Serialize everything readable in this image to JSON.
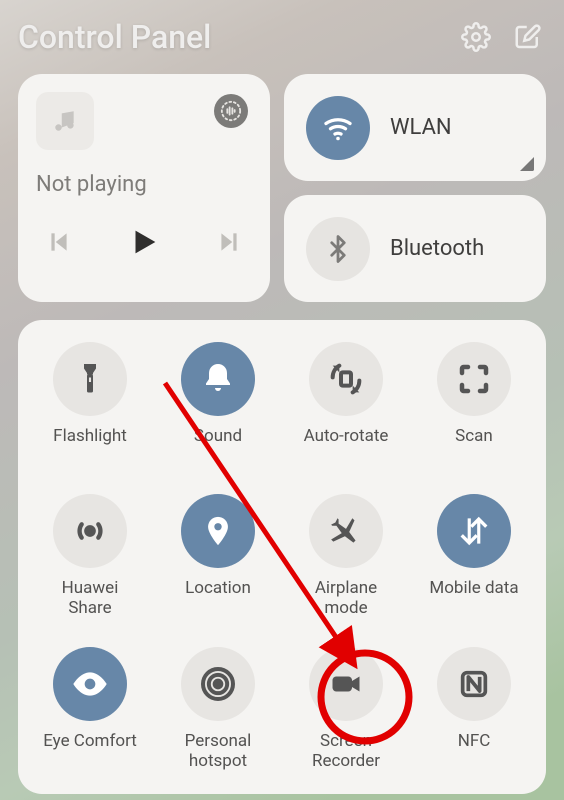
{
  "header": {
    "title": "Control Panel"
  },
  "music": {
    "status": "Not playing"
  },
  "conn": {
    "wlan": {
      "label": "WLAN",
      "on": true
    },
    "bluetooth": {
      "label": "Bluetooth",
      "on": false
    }
  },
  "toggles": [
    {
      "id": "flashlight",
      "label": "Flashlight",
      "icon": "flashlight",
      "on": false
    },
    {
      "id": "sound",
      "label": "Sound",
      "icon": "bell",
      "on": true
    },
    {
      "id": "autorotate",
      "label": "Auto-rotate",
      "icon": "rotate",
      "on": false
    },
    {
      "id": "scan",
      "label": "Scan",
      "icon": "scan",
      "on": false
    },
    {
      "id": "huaweishare",
      "label": "Huawei\nShare",
      "icon": "broadcast",
      "on": false
    },
    {
      "id": "location",
      "label": "Location",
      "icon": "location",
      "on": true
    },
    {
      "id": "airplane",
      "label": "Airplane\nmode",
      "icon": "airplane",
      "on": false
    },
    {
      "id": "mobiledata",
      "label": "Mobile data",
      "icon": "data",
      "on": true
    },
    {
      "id": "eyecomfort",
      "label": "Eye Comfort",
      "icon": "eye",
      "on": true
    },
    {
      "id": "hotspot",
      "label": "Personal\nhotspot",
      "icon": "hotspot",
      "on": false
    },
    {
      "id": "screenrecorder",
      "label": "Screen\nRecorder",
      "icon": "camera",
      "on": false
    },
    {
      "id": "nfc",
      "label": "NFC",
      "icon": "nfc",
      "on": false
    }
  ],
  "annotation": {
    "highlight_toggle": "screenrecorder"
  }
}
